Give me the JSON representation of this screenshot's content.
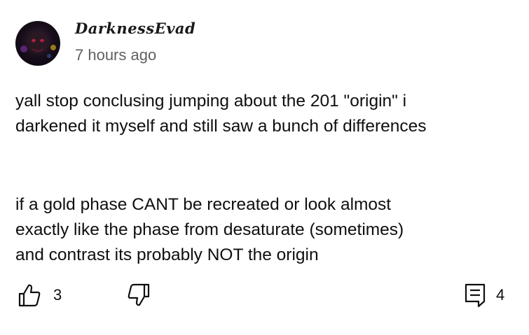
{
  "comment": {
    "author": "DarknessEvad",
    "timestamp": "7 hours ago",
    "paragraphs": [
      "yall stop conclusing jumping about the 201 \"origin\" i\ndarkened it myself and still saw a bunch of differences",
      "if a gold phase CANT be recreated or look almost\nexactly like the phase from desaturate (sometimes)\nand contrast its probably NOT the origin"
    ]
  },
  "actions": {
    "like_count": "3",
    "reply_count": "4"
  },
  "icons": {
    "like": "thumbs-up-icon",
    "dislike": "thumbs-down-icon",
    "reply": "comment-reply-icon"
  }
}
